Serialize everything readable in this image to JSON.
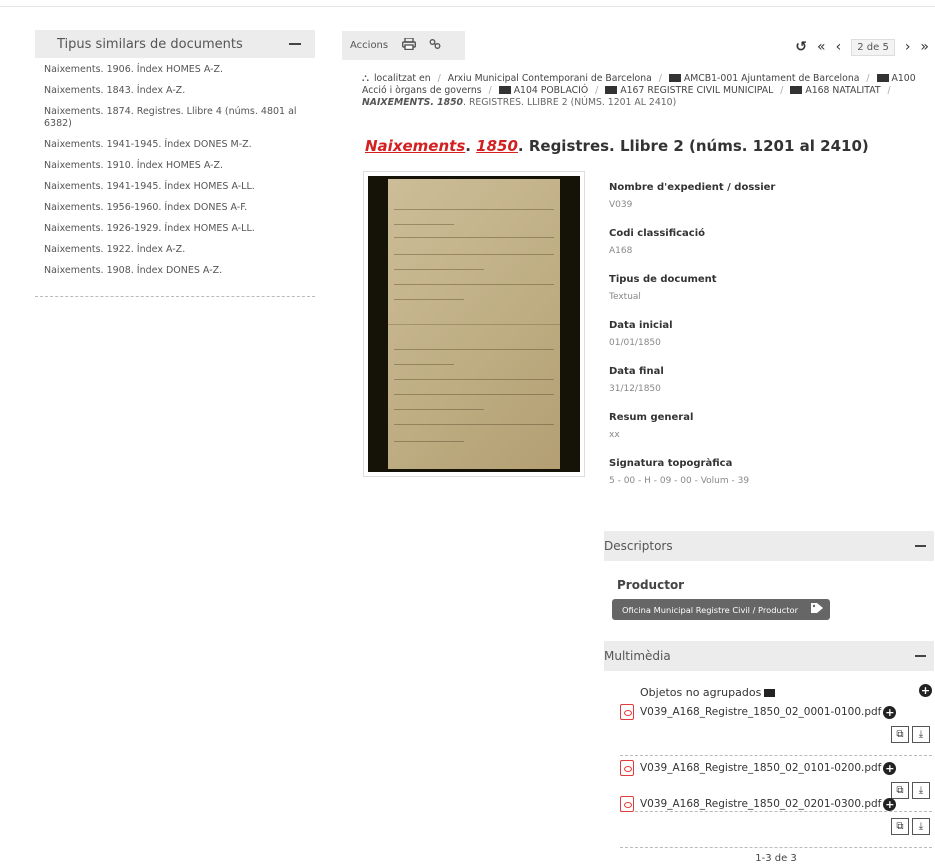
{
  "sidebar": {
    "title": "Tipus similars de documents",
    "items": [
      "Naixements. 1906. Índex HOMES A-Z.",
      "Naixements. 1843. Índex A-Z.",
      "Naixements. 1874. Registres. Llibre 4 (núms. 4801 al 6382)",
      "Naixements. 1941-1945. Índex DONES M-Z.",
      "Naixements. 1910. Índex HOMES A-Z.",
      "Naixements. 1941-1945. Índex HOMES A-LL.",
      "Naixements. 1956-1960. Índex DONES A-F.",
      "Naixements. 1926-1929. Índex HOMES A-LL.",
      "Naixements. 1922. Índex A-Z.",
      "Naixements. 1908. Índex DONES A-Z."
    ]
  },
  "toolbar": {
    "actions_label": "Accions",
    "print_icon": "print-icon",
    "link_icon": "link-icon"
  },
  "pager": {
    "reload": "↺",
    "first": "«",
    "prev": "‹",
    "current": "2 de 5",
    "next": "›",
    "last": "»"
  },
  "breadcrumb": {
    "located_in": "localitzat en",
    "items": [
      "Arxiu Municipal Contemporani de Barcelona",
      "AMCB1-001 Ajuntament de Barcelona",
      "A100 Acció i òrgans de governs",
      "A104 POBLACIÓ",
      "A167 REGISTRE CIVIL MUNICIPAL",
      "A168 NATALITAT"
    ],
    "current_em_a": "Naixements. 1850",
    "current_rest": ". Registres. Llibre 2 (núms. 1201 al 2410)"
  },
  "title": {
    "part1": "Naixements",
    "dot1": ". ",
    "part2": "1850",
    "rest": ". Registres. Llibre 2 (núms. 1201 al 2410)"
  },
  "metadata": [
    {
      "label": "Nombre d'expedient / dossier",
      "value": "V039"
    },
    {
      "label": "Codi classificació",
      "value": "A168"
    },
    {
      "label": "Tipus de document",
      "value": "Textual"
    },
    {
      "label": "Data inicial",
      "value": "01/01/1850"
    },
    {
      "label": "Data final",
      "value": "31/12/1850"
    },
    {
      "label": "Resum general",
      "value": "xx"
    },
    {
      "label": "Signatura topogràfica",
      "value": "5 - 00 - H - 09 - 00 - Volum - 39"
    }
  ],
  "descriptors": {
    "title": "Descriptors",
    "producer_label": "Productor",
    "tag": "Oficina Municipal Registre Civil / Productor"
  },
  "multimedia": {
    "title": "Multimèdia",
    "group": "Objetos no agrupados",
    "files": [
      "V039_A168_Registre_1850_02_0001-0100.pdf",
      "V039_A168_Registre_1850_02_0101-0200.pdf",
      "V039_A168_Registre_1850_02_0201-0300.pdf"
    ],
    "count": "1-3 de 3"
  }
}
